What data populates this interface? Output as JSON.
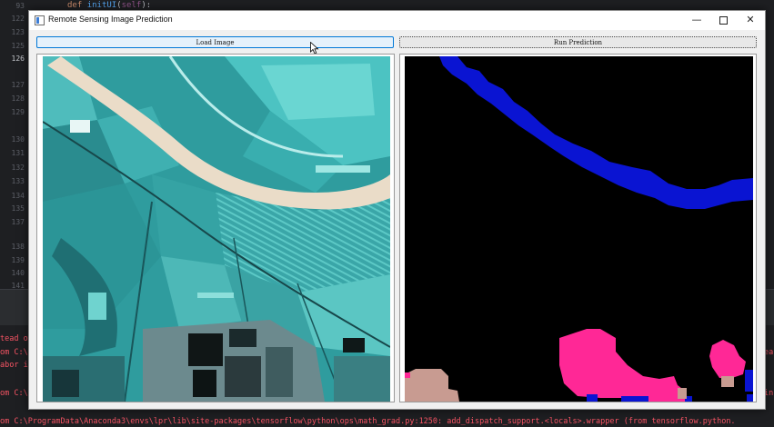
{
  "ide": {
    "line_numbers": [
      "93",
      "122",
      "123",
      "125",
      "126",
      "127",
      "128",
      "129",
      "130",
      "131",
      "132",
      "133",
      "134",
      "135",
      "137",
      "138",
      "139",
      "140",
      "141"
    ],
    "active_line": "126",
    "code_def": "def",
    "code_fn": "initUI",
    "code_self": "self",
    "code_rest": "):",
    "console_lines": [
      "tead o",
      "om C:\\",
      "abor i",
      "om C:\\",
      "om C:\\ProgramData\\Anaconda3\\envs\\lpr\\lib\\site-packages\\tensorflow\\python\\ops\\math_grad.py:1250: add_dispatch_support.<locals>.wrapper (from tensorflow.python."
    ],
    "console_right_fragments": [
      "ea",
      "in"
    ]
  },
  "window": {
    "title": "Remote Sensing Image Prediction",
    "minimize_glyph": "—",
    "close_glyph": "✕",
    "load_button": "Load Image",
    "run_button": "Run Prediction"
  },
  "colors": {
    "window_bg": "#f0f0f0",
    "load_button_bg": "#e5f1fb",
    "load_button_border": "#0078d7",
    "prediction_water": "#0a14d2",
    "prediction_building": "#ff2896",
    "prediction_bareland": "#c89b91",
    "prediction_background": "#000000"
  }
}
